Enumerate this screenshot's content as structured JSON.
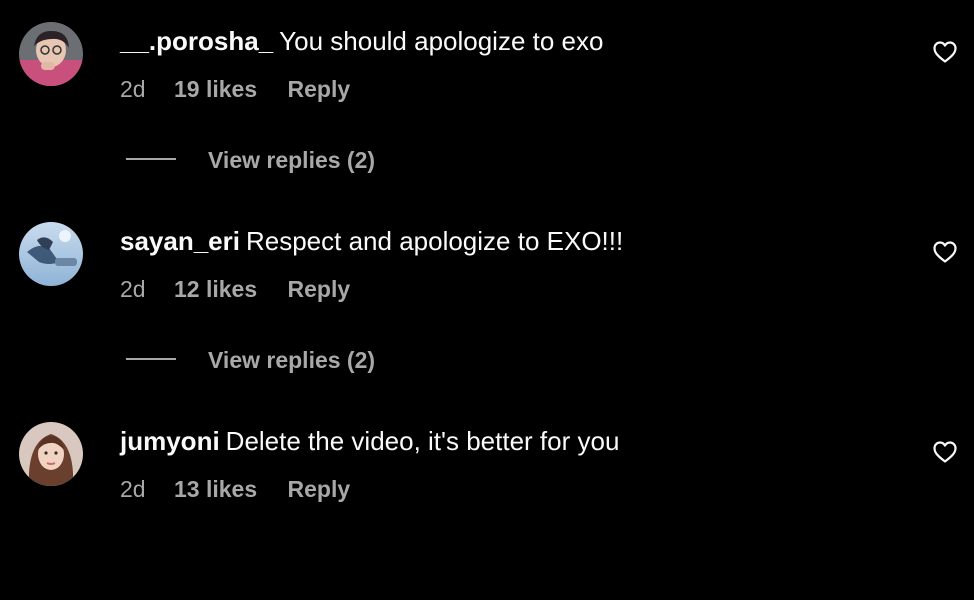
{
  "comments": [
    {
      "username": "__.porosha_",
      "text": "You should apologize to exo",
      "age": "2d",
      "likes": "19 likes",
      "reply_label": "Reply",
      "view_replies_label": "View replies (2)"
    },
    {
      "username": "sayan_eri",
      "text": "Respect and apologize to EXO!!!",
      "age": "2d",
      "likes": "12 likes",
      "reply_label": "Reply",
      "view_replies_label": "View replies (2)"
    },
    {
      "username": "jumyoni",
      "text": "Delete the video, it's better for you",
      "age": "2d",
      "likes": "13 likes",
      "reply_label": "Reply"
    }
  ],
  "icons": {
    "like": "heart-outline-icon",
    "avatar": "user-avatar"
  },
  "colors": {
    "background": "#000000",
    "primary_text": "#fafafa",
    "secondary_text": "#a8a8a8"
  }
}
